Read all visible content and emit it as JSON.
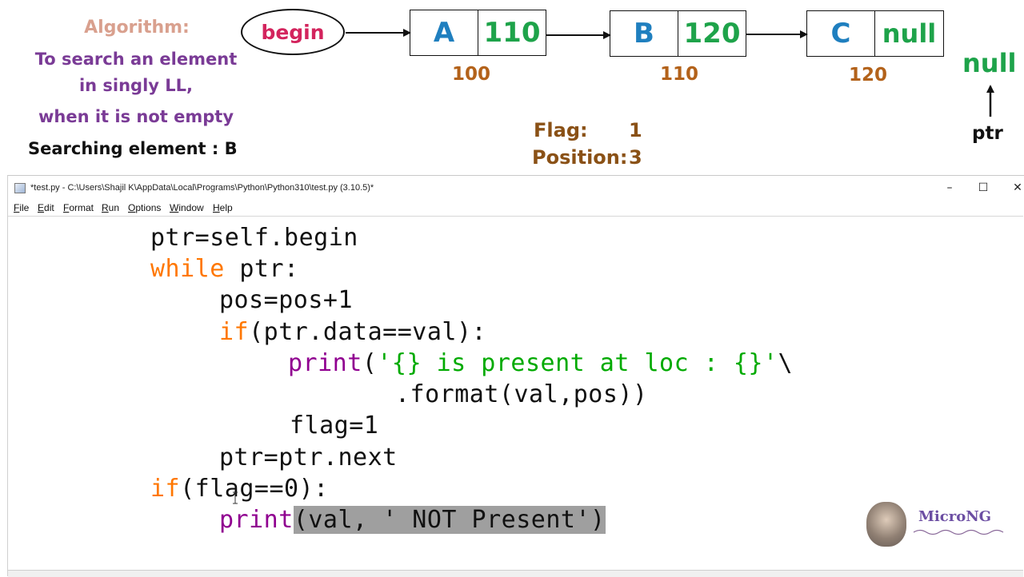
{
  "slide": {
    "algo_title": "Algorithm:",
    "algo_desc_1": "To search an element",
    "algo_desc_2": "in singly LL,",
    "algo_desc_3": "when it is not empty",
    "search_prefix": "Searching element : ",
    "search_value": "B",
    "begin_label": "begin",
    "nodes": [
      {
        "data": "A",
        "next": "110",
        "address": "100"
      },
      {
        "data": "B",
        "next": "120",
        "address": "110"
      },
      {
        "data": "C",
        "next": "null",
        "address": "120"
      }
    ],
    "end_null": "null",
    "ptr_label": "ptr",
    "flag_label": "Flag:",
    "flag_value": "1",
    "position_label": "Position:",
    "position_value": "3",
    "colors": {
      "begin_text": "#d3245d",
      "node_data": "#1f7fbf",
      "node_next": "#1ea34a",
      "address": "#b3621a",
      "algo_title": "#d9a08e",
      "algo_desc": "#7a3b96",
      "flag": "#8a5116"
    }
  },
  "window": {
    "title": "*test.py - C:\\Users\\Shajil K\\AppData\\Local\\Programs\\Python\\Python310\\test.py (3.10.5)*",
    "controls": {
      "minimize": "–",
      "maximize": "☐",
      "close": "✕"
    },
    "menu": [
      {
        "ul": "F",
        "rest": "ile"
      },
      {
        "ul": "E",
        "rest": "dit"
      },
      {
        "ul": "F",
        "rest": "ormat"
      },
      {
        "ul": "R",
        "rest": "un"
      },
      {
        "ul": "O",
        "rest": "ptions"
      },
      {
        "ul": "W",
        "rest": "indow"
      },
      {
        "ul": "H",
        "rest": "elp"
      }
    ]
  },
  "code": {
    "l1": "ptr=self.begin",
    "l2_kw": "while",
    "l2_rest": " ptr:",
    "l3": "pos=pos+1",
    "l4_kw": "if",
    "l4_rest": "(ptr.data==val):",
    "l5_bi": "print",
    "l5_open": "(",
    "l5_str": "'{} is present at loc : {}'",
    "l5_tail": "\\",
    "l6": ".format(val,pos))",
    "l7": "flag=1",
    "l8": "ptr=ptr.next",
    "l9_kw": "if",
    "l9_rest": "(flag==0):",
    "l10_bi": "print",
    "l10_sel": "(val, ' NOT Present')"
  },
  "watermark": {
    "brand": "MicroNG"
  }
}
